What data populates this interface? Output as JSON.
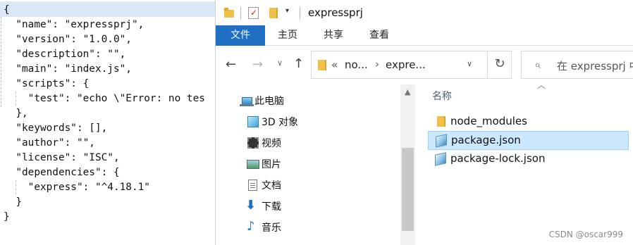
{
  "editor": {
    "lines": [
      "{",
      "  \"name\": \"expressprj\",",
      "  \"version\": \"1.0.0\",",
      "  \"description\": \"\",",
      "  \"main\": \"index.js\",",
      "  \"scripts\": {",
      "    \"test\": \"echo \\\"Error: no tes",
      "  },",
      "  \"keywords\": [],",
      "  \"author\": \"\",",
      "  \"license\": \"ISC\",",
      "  \"dependencies\": {",
      "    \"express\": \"^4.18.1\"",
      "  }",
      "}"
    ]
  },
  "explorer": {
    "window_title": "expressprj",
    "ribbon_tabs": [
      "文件",
      "主页",
      "共享",
      "查看"
    ],
    "address": {
      "overflow": "«",
      "segment_1": "no...",
      "segment_2": "expre..."
    },
    "search_placeholder": "在 expressprj 中",
    "nav_items": [
      {
        "label": "此电脑",
        "icon": "pc-icon"
      },
      {
        "label": "3D 对象",
        "icon": "cube-icon"
      },
      {
        "label": "视频",
        "icon": "film-icon"
      },
      {
        "label": "图片",
        "icon": "picture-icon"
      },
      {
        "label": "文档",
        "icon": "document-icon"
      },
      {
        "label": "下载",
        "icon": "download-icon"
      },
      {
        "label": "音乐",
        "icon": "music-icon"
      }
    ],
    "column_header": "名称",
    "files": [
      {
        "name": "node_modules",
        "type": "folder",
        "selected": false
      },
      {
        "name": "package.json",
        "type": "json",
        "selected": true
      },
      {
        "name": "package-lock.json",
        "type": "json",
        "selected": false
      }
    ]
  },
  "watermark": "CSDN @oscar999",
  "colors": {
    "ribbon_active": "#1f6fc5",
    "selection_bg": "#cce8ff",
    "folder": "#f1c04a"
  }
}
